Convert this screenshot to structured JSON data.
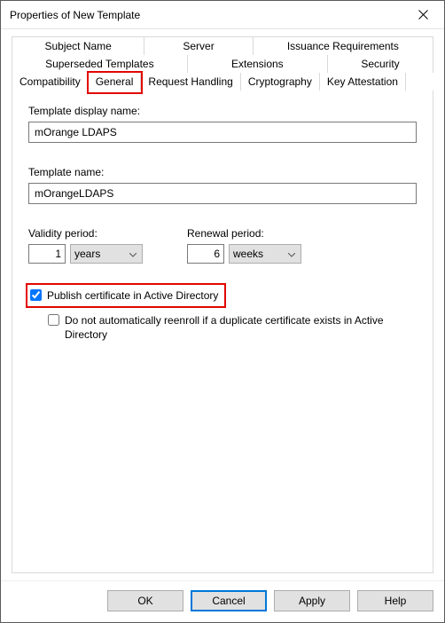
{
  "window": {
    "title": "Properties of New Template"
  },
  "tabs": {
    "row1": [
      "Subject Name",
      "Server",
      "Issuance Requirements"
    ],
    "row2": [
      "Superseded Templates",
      "Extensions",
      "Security"
    ],
    "row3": [
      "Compatibility",
      "General",
      "Request Handling",
      "Cryptography",
      "Key Attestation"
    ],
    "active": "General"
  },
  "general": {
    "display_name_label": "Template display name:",
    "display_name_value": "mOrange LDAPS",
    "template_name_label": "Template name:",
    "template_name_value": "mOrangeLDAPS",
    "validity_label": "Validity period:",
    "validity_value": "1",
    "validity_unit": "years",
    "renewal_label": "Renewal period:",
    "renewal_value": "6",
    "renewal_unit": "weeks",
    "publish_label": "Publish certificate in Active Directory",
    "noreenroll_label": "Do not automatically reenroll if a duplicate certificate exists in Active Directory"
  },
  "buttons": {
    "ok": "OK",
    "cancel": "Cancel",
    "apply": "Apply",
    "help": "Help"
  }
}
